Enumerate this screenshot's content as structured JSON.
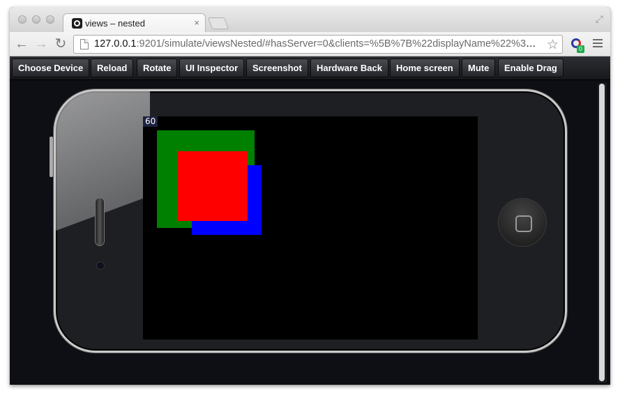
{
  "browser": {
    "tab_title": "views – nested",
    "tab_close": "×",
    "url_host": "127.0.0.1",
    "url_rest": ":9201/simulate/viewsNested/#hasServer=0&clients=%5B%7B%22displayName%22%3A%22...",
    "back_glyph": "←",
    "forward_glyph": "→",
    "reload_glyph": "↻",
    "star_glyph": "☆",
    "fullscreen_glyph": "⤢",
    "extension_badge": "0"
  },
  "simulator_toolbar": {
    "buttons": [
      "Choose Device",
      "Reload",
      "Rotate",
      "UI Inspector",
      "Screenshot",
      "Hardware Back",
      "Home screen",
      "Mute",
      "Enable Drag"
    ]
  },
  "device": {
    "fps_counter": "60",
    "views": {
      "outer_color": "#008000",
      "middle_color": "#0000ff",
      "inner_color": "#ff0000"
    }
  },
  "colors": {
    "screen_background": "#000000",
    "page_background": "#0e0f14"
  }
}
